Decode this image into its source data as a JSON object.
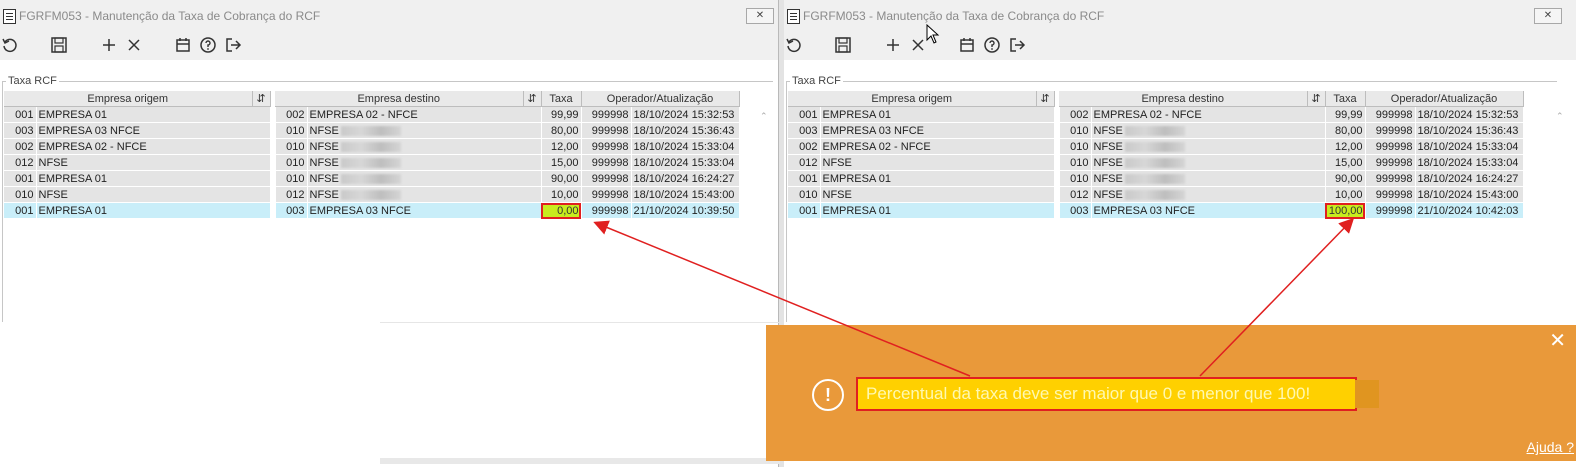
{
  "left_window": {
    "title": "FGRFM053 - Manutenção da Taxa de Cobrança do RCF",
    "section": "Taxa RCF",
    "columns": [
      "Empresa origem",
      "Empresa destino",
      "Taxa",
      "Operador/Atualização"
    ],
    "rows": [
      {
        "orig_code": "001",
        "orig_name": "EMPRESA 01",
        "dest_code": "002",
        "dest_name": "EMPRESA 02 - NFCE",
        "taxa": "99,99",
        "operator": "999998",
        "updated": "18/10/2024 15:32:53"
      },
      {
        "orig_code": "003",
        "orig_name": "EMPRESA 03 NFCE",
        "dest_code": "010",
        "dest_name": "NFSE",
        "taxa": "80,00",
        "operator": "999998",
        "updated": "18/10/2024 15:36:43"
      },
      {
        "orig_code": "002",
        "orig_name": "EMPRESA 02 - NFCE",
        "dest_code": "010",
        "dest_name": "NFSE",
        "taxa": "12,00",
        "operator": "999998",
        "updated": "18/10/2024 15:33:04"
      },
      {
        "orig_code": "012",
        "orig_name": "NFSE",
        "dest_code": "010",
        "dest_name": "NFSE",
        "taxa": "15,00",
        "operator": "999998",
        "updated": "18/10/2024 15:33:04"
      },
      {
        "orig_code": "001",
        "orig_name": "EMPRESA 01",
        "dest_code": "010",
        "dest_name": "NFSE",
        "taxa": "90,00",
        "operator": "999998",
        "updated": "18/10/2024 16:24:27"
      },
      {
        "orig_code": "010",
        "orig_name": "NFSE",
        "dest_code": "012",
        "dest_name": "NFSE",
        "taxa": "10,00",
        "operator": "999998",
        "updated": "18/10/2024 15:43:00"
      },
      {
        "orig_code": "001",
        "orig_name": "EMPRESA 01",
        "dest_code": "003",
        "dest_name": "EMPRESA 03 NFCE",
        "taxa": "0,00",
        "operator": "999998",
        "updated": "21/10/2024 10:39:50"
      }
    ]
  },
  "right_window": {
    "title": "FGRFM053 - Manutenção da Taxa de Cobrança do RCF",
    "section": "Taxa RCF",
    "columns": [
      "Empresa origem",
      "Empresa destino",
      "Taxa",
      "Operador/Atualização"
    ],
    "rows": [
      {
        "orig_code": "001",
        "orig_name": "EMPRESA 01",
        "dest_code": "002",
        "dest_name": "EMPRESA 02 - NFCE",
        "taxa": "99,99",
        "operator": "999998",
        "updated": "18/10/2024 15:32:53"
      },
      {
        "orig_code": "003",
        "orig_name": "EMPRESA 03 NFCE",
        "dest_code": "010",
        "dest_name": "NFSE",
        "taxa": "80,00",
        "operator": "999998",
        "updated": "18/10/2024 15:36:43"
      },
      {
        "orig_code": "002",
        "orig_name": "EMPRESA 02 - NFCE",
        "dest_code": "010",
        "dest_name": "NFSE",
        "taxa": "12,00",
        "operator": "999998",
        "updated": "18/10/2024 15:33:04"
      },
      {
        "orig_code": "012",
        "orig_name": "NFSE",
        "dest_code": "010",
        "dest_name": "NFSE",
        "taxa": "15,00",
        "operator": "999998",
        "updated": "18/10/2024 15:33:04"
      },
      {
        "orig_code": "001",
        "orig_name": "EMPRESA 01",
        "dest_code": "010",
        "dest_name": "NFSE",
        "taxa": "90,00",
        "operator": "999998",
        "updated": "18/10/2024 16:24:27"
      },
      {
        "orig_code": "010",
        "orig_name": "NFSE",
        "dest_code": "012",
        "dest_name": "NFSE",
        "taxa": "10,00",
        "operator": "999998",
        "updated": "18/10/2024 15:43:00"
      },
      {
        "orig_code": "001",
        "orig_name": "EMPRESA 01",
        "dest_code": "003",
        "dest_name": "EMPRESA 03 NFCE",
        "taxa": "100,00",
        "operator": "999998",
        "updated": "21/10/2024 10:42:03"
      }
    ]
  },
  "toolbar_icons": [
    "undo-icon",
    "save-icon",
    "add-icon",
    "delete-icon",
    "calendar-icon",
    "help-icon",
    "exit-icon"
  ],
  "toast": {
    "message": "Percentual da taxa deve ser maior que 0 e menor que 100!",
    "help_link": "Ajuda ?",
    "close": "✕",
    "icon": "!"
  },
  "window_close": "✕",
  "colors": {
    "toast_bg": "#e9993a",
    "highlight": "#ffd000",
    "annotation": "#e02020",
    "selected_row": "#c9eef9",
    "taxa_highlight": "#c8ec1e"
  }
}
